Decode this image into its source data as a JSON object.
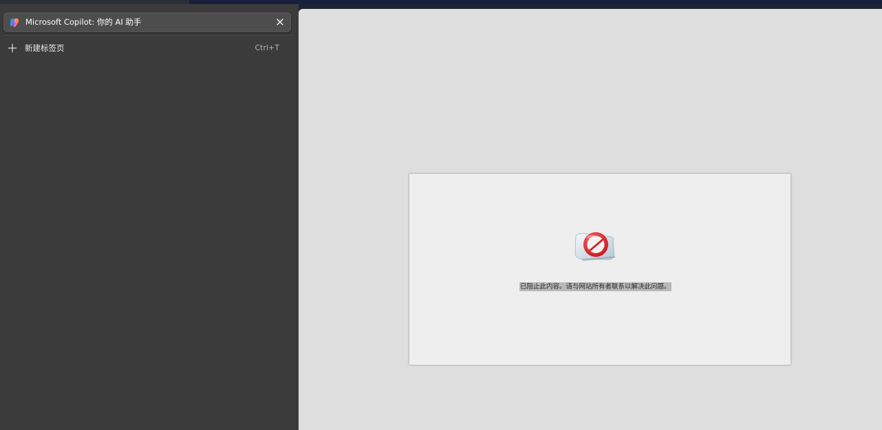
{
  "sidebar": {
    "active_tab": {
      "title": "Microsoft Copilot: 你的 AI 助手",
      "favicon": "copilot-icon",
      "close_icon": "close-icon"
    },
    "new_tab": {
      "label": "新建标签页",
      "shortcut": "Ctrl+T",
      "icon": "plus-icon"
    }
  },
  "content": {
    "blocked_message": "已阻止此内容。请与网站所有者联系以解决此问题。",
    "blocked_icon": "blocked-icon"
  },
  "colors": {
    "sidebar_bg": "#3b3b3b",
    "tab_bg": "#4d4d4d",
    "content_bg": "#dedede",
    "box_bg": "#eeeeee",
    "blocked_red": "#e0262b"
  }
}
